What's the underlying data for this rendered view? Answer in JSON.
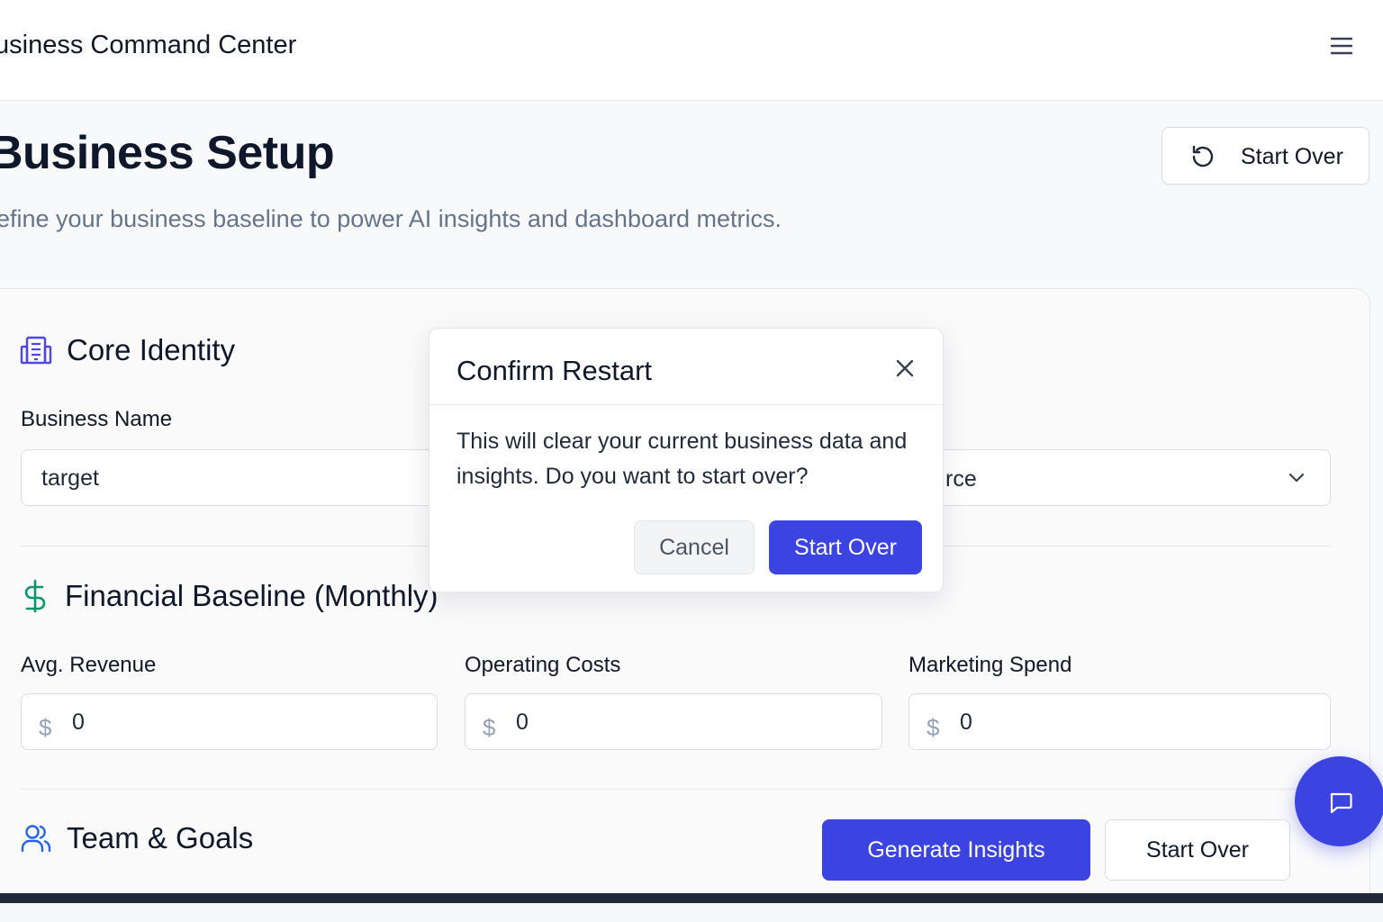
{
  "header": {
    "app_title": "usiness Command Center",
    "menu_icon": "hamburger-menu-icon"
  },
  "page": {
    "title": "Business Setup",
    "subtitle": "efine your business baseline to power AI insights and dashboard metrics.",
    "start_over_label": "Start Over",
    "start_over_icon": "rotate-ccw-icon"
  },
  "sections": {
    "core_identity": {
      "title": "Core Identity",
      "icon": "building-icon",
      "business_name_label": "Business Name",
      "business_name_value": "target",
      "select_partial_value": "rce"
    },
    "financial": {
      "title": "Financial Baseline (Monthly)",
      "icon": "dollar-icon",
      "currency_symbol": "$",
      "fields": [
        {
          "label": "Avg. Revenue",
          "value": "0"
        },
        {
          "label": "Operating Costs",
          "value": "0"
        },
        {
          "label": "Marketing Spend",
          "value": "0"
        }
      ]
    },
    "team_goals": {
      "title": "Team & Goals",
      "icon": "users-icon"
    }
  },
  "actions": {
    "generate_label": "Generate Insights",
    "start_over_label": "Start Over"
  },
  "chat": {
    "icon": "message-square-icon"
  },
  "modal": {
    "title": "Confirm Restart",
    "body": "This will clear your current business data and insights. Do you want to start over?",
    "cancel_label": "Cancel",
    "confirm_label": "Start Over"
  },
  "colors": {
    "primary": "#3b44e0",
    "icon_indigo": "#4f46e5",
    "icon_green": "#059669",
    "icon_blue": "#2563eb",
    "text_muted": "#64748b"
  }
}
